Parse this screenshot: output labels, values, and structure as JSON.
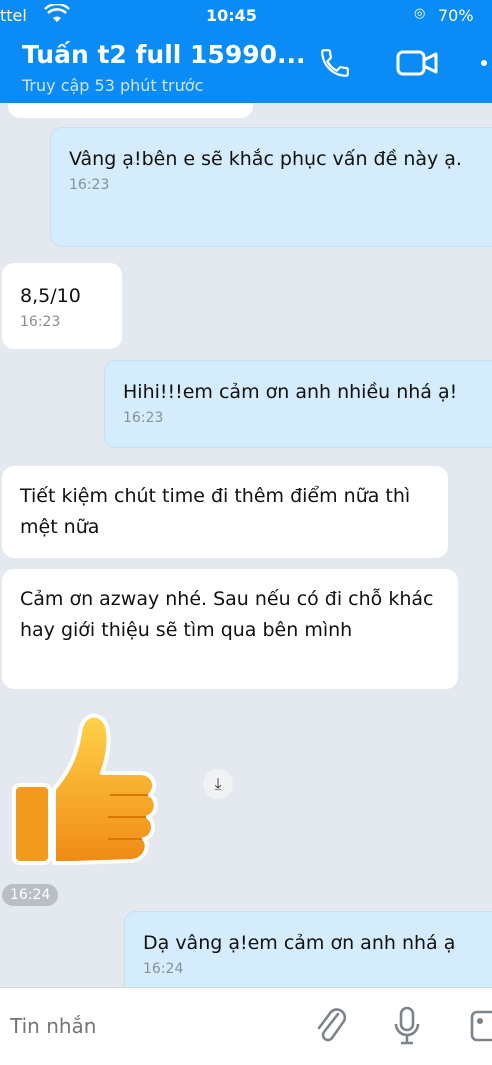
{
  "status_bar": {
    "carrier": "ttel",
    "time": "10:45",
    "battery": "70%"
  },
  "header": {
    "title": "Tuấn t2 full 15990...",
    "subtitle": "Truy cập 53 phút trước"
  },
  "messages": [
    {
      "text": "Vâng ạ!bên e sẽ khắc phục vấn đề này ạ.",
      "time": "16:23"
    },
    {
      "text": "8,5/10",
      "time": "16:23"
    },
    {
      "text": "Hihi!!!em cảm ơn anh nhiều nhá ạ!",
      "time": "16:23"
    },
    {
      "text": "Tiết kiệm chút time đi thêm điểm nữa thì mệt nữa"
    },
    {
      "text": "Cảm ơn azway nhé. Sau nếu có đi chỗ khác hay giới thiệu sẽ tìm qua bên mình"
    },
    {
      "text": "Dạ vâng ạ!em cảm ơn anh nhá ạ",
      "time": "16:24"
    }
  ],
  "sticker": {
    "icon": "thumbs-up-icon",
    "time_badge": "16:24"
  },
  "input": {
    "placeholder": "Tin nhắn"
  },
  "colors": {
    "header_bg": "#0a8bf5",
    "chat_bg": "#e4e8ef",
    "outgoing_bubble": "#d4ecfc",
    "incoming_bubble": "#ffffff"
  }
}
